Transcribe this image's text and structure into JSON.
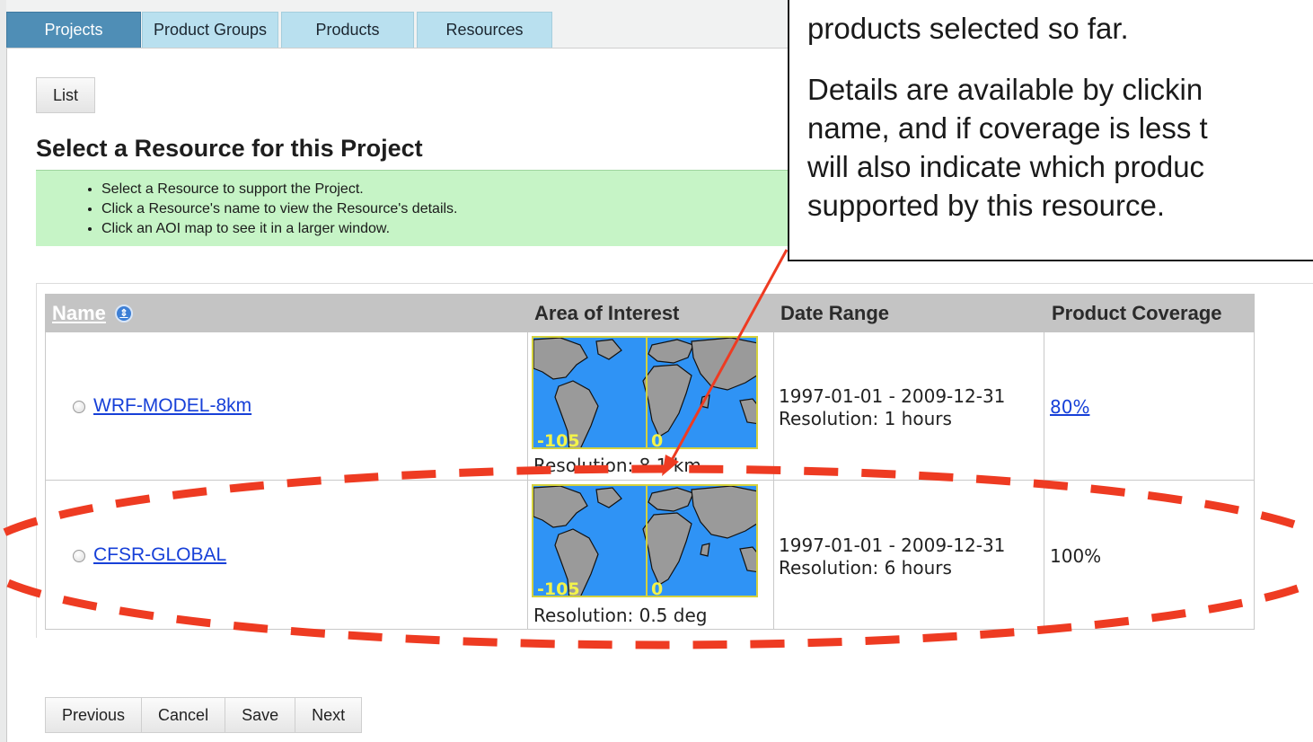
{
  "tabs": [
    {
      "label": "Projects",
      "active": true
    },
    {
      "label": "Product Groups",
      "active": false
    },
    {
      "label": "Products",
      "active": false
    },
    {
      "label": "Resources",
      "active": false
    }
  ],
  "list_button": "List",
  "heading": "Select a Resource for this Project",
  "notice_items": [
    "Select a Resource to support the Project.",
    "Click a Resource's name to view the Resource's details.",
    "Click an AOI map to see it in a larger window."
  ],
  "table": {
    "headers": {
      "name": "Name",
      "aoi": "Area of Interest",
      "date_range": "Date Range",
      "coverage": "Product Coverage"
    },
    "rows": [
      {
        "name": "WRF-MODEL-8km",
        "aoi_left_label": "-105",
        "aoi_right_label": "0",
        "aoi_resolution": "Resolution: 8.1 km",
        "dates": "1997-01-01 - 2009-12-31",
        "date_resolution": "Resolution: 1 hours",
        "coverage": "80%"
      },
      {
        "name": "CFSR-GLOBAL",
        "aoi_left_label": "-105",
        "aoi_right_label": "0",
        "aoi_resolution": "Resolution: 0.5 deg",
        "dates": "1997-01-01 - 2009-12-31",
        "date_resolution": "Resolution: 6 hours",
        "coverage": "100%"
      }
    ]
  },
  "buttons": {
    "previous": "Previous",
    "cancel": "Cancel",
    "save": "Save",
    "next": "Next"
  },
  "callout": {
    "lines": [
      "products selected so far.",
      "Details are available by clickin",
      "name, and if coverage is less t",
      "will also indicate which produc",
      "supported by this resource."
    ]
  },
  "colors": {
    "tab_active": "#4f8eb6",
    "tab_inactive": "#b9e0ef",
    "notice_bg": "#c6f4c6",
    "annotation_red": "#ee3b22",
    "map_ocean": "#2f93f5"
  }
}
